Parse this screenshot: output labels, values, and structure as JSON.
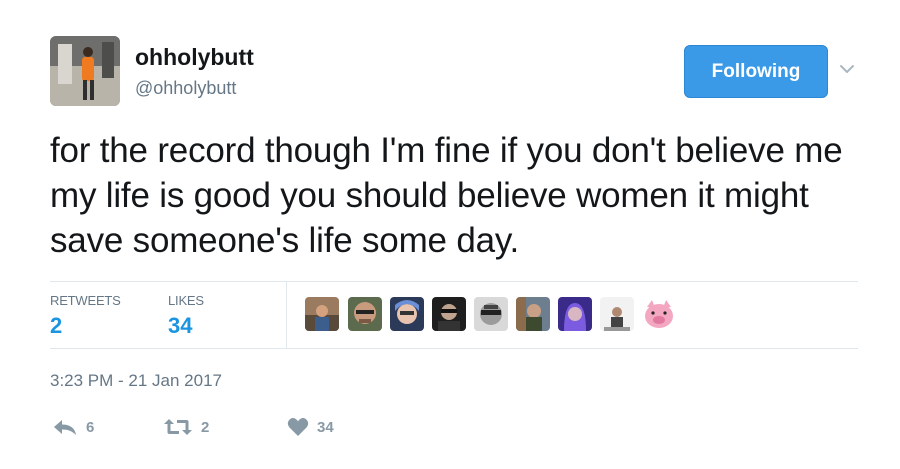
{
  "user": {
    "display_name": "ohholybutt",
    "handle": "@ohholybutt"
  },
  "follow_button": {
    "label": "Following"
  },
  "tweet": {
    "text": "for the record though I'm fine if you don't believe me my life is good you should believe women it might save someone's life some day.",
    "timestamp": "3:23 PM - 21 Jan 2017"
  },
  "stats": {
    "retweets_label": "RETWEETS",
    "retweets_value": "2",
    "likes_label": "LIKES",
    "likes_value": "34"
  },
  "actions": {
    "reply_count": "6",
    "retweet_count": "2",
    "like_count": "34"
  },
  "colors": {
    "accent": "#1b95e0",
    "follow_button_bg": "#3b9ae8",
    "muted_text": "#657786",
    "action_icon": "#8899a6"
  }
}
